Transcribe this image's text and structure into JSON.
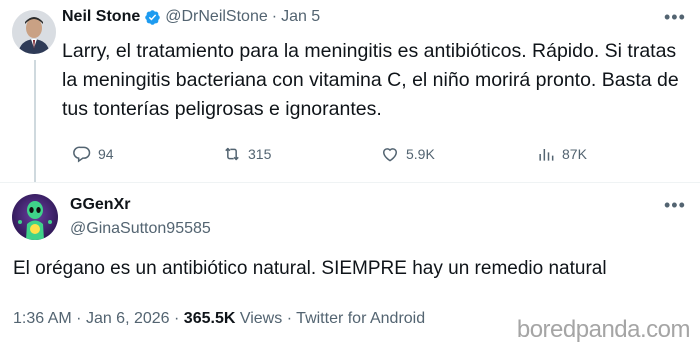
{
  "tweet1": {
    "display_name": "Neil Stone",
    "handle": "@DrNeilStone",
    "separator": "·",
    "date": "Jan 5",
    "text": "Larry, el tratamiento para la meningitis es antibióticos. Rápido. Si tratas la meningitis bacteriana con vitamina C, el niño morirá pronto. Basta de tus tonterías peligrosas e ignorantes.",
    "actions": {
      "replies": "94",
      "retweets": "315",
      "likes": "5.9K",
      "views": "87K"
    },
    "more_icon": "more-options-icon",
    "verified_icon": "verified-badge-icon"
  },
  "tweet2": {
    "display_name": "GGenXr",
    "handle": "@GinaSutton95585",
    "text": "El orégano es un antibiótico natural. SIEMPRE hay un remedio natural",
    "meta": {
      "time": "1:36 AM",
      "sep1": "·",
      "date": "Jan 6, 2026",
      "sep2": "·",
      "views_count": "365.5K",
      "views_label": "Views",
      "sep3": "·",
      "client": "Twitter for Android"
    },
    "more_icon": "more-options-icon"
  },
  "watermark": "boredpanda.com",
  "colors": {
    "text": "#0f1419",
    "secondary": "#536471",
    "verified": "#1d9bf0",
    "thread_line": "#cfd9de"
  }
}
